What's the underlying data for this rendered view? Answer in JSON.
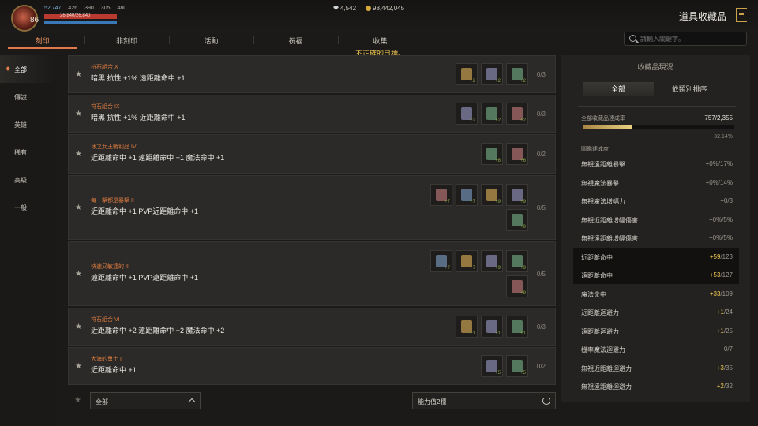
{
  "player": {
    "level": "86",
    "stats": [
      "52,747",
      "426",
      "390",
      "305",
      "480"
    ],
    "hp": "26,840/26,840",
    "hp_fraction": 1.0,
    "mp_fraction": 1.0
  },
  "currency": {
    "diamonds": "4,542",
    "gold": "98,442,045"
  },
  "window_title": "道具收藏品",
  "tabs": [
    "刻印",
    "非刻印",
    "活動",
    "祝福",
    "收集"
  ],
  "search": {
    "placeholder": "請輸入關鍵字。"
  },
  "warning": "不正確的目標。",
  "sidebar": [
    "全部",
    "傳說",
    "英雄",
    "稀有",
    "高級",
    "一般"
  ],
  "collections": [
    {
      "name": "符石組合 X",
      "effect": "暗黑 抗性 +1% 遠距離命中 +1",
      "count": "0/3",
      "slots": [
        "+2",
        "+2",
        "+2"
      ]
    },
    {
      "name": "符石組合 IX",
      "effect": "暗黑 抗性 +1% 近距離命中 +1",
      "count": "0/3",
      "slots": [
        "+2",
        "+2",
        "+2"
      ]
    },
    {
      "name": "冰之女王戰利品 IV",
      "effect": "近距離命中 +1 遠距離命中 +1 魔法命中 +1",
      "count": "0/2",
      "slots": [
        "+6",
        "+6"
      ]
    },
    {
      "name": "每一擊都是暴擊 II",
      "effect": "近距離命中 +1 PVP近距離命中 +1",
      "count": "0/5",
      "slots": [
        "+7",
        "+7",
        "+9",
        "+9",
        "+9"
      ]
    },
    {
      "name": "快速又敏捷的 II",
      "effect": "遠距離命中 +1 PVP遠距離命中 +1",
      "count": "0/5",
      "slots": [
        "+7",
        "+7",
        "+9",
        "+9",
        "+9"
      ]
    },
    {
      "name": "符石組合 VI",
      "effect": "近距離命中 +2 遠距離命中 +2 魔法命中 +2",
      "count": "0/3",
      "slots": [
        "+1",
        "+1",
        "+1"
      ]
    },
    {
      "name": "大海的勇士 I",
      "effect": "近距離命中 +1",
      "count": "0/2",
      "slots": [
        "+5",
        "+5"
      ]
    }
  ],
  "bottom": {
    "filter": "全部",
    "power_filter": "能力值2種"
  },
  "panel": {
    "title": "收藏品現況",
    "tabs": [
      "全部",
      "依類別排序"
    ],
    "progress_label": "全部收藏品達成率",
    "progress_value": "757/2,355",
    "progress_pct": "32.14%",
    "progress_fraction": 0.3214,
    "sub_label": "圖鑑達成度",
    "stats": [
      {
        "name": "無視遠距離暴擊",
        "bonus": "",
        "value": "+0%/17%",
        "highlight": false
      },
      {
        "name": "無視魔法暴擊",
        "bonus": "",
        "value": "+0%/14%",
        "highlight": false
      },
      {
        "name": "無視魔法增幅力",
        "bonus": "",
        "value": "+0/3",
        "highlight": false
      },
      {
        "name": "無視近距離增幅傷害",
        "bonus": "",
        "value": "+0%/5%",
        "highlight": false
      },
      {
        "name": "無視遠距離增幅傷害",
        "bonus": "",
        "value": "+0%/5%",
        "highlight": false
      },
      {
        "name": "近距離命中",
        "bonus": "+59",
        "value": "/123",
        "highlight": true
      },
      {
        "name": "遠距離命中",
        "bonus": "+53",
        "value": "/127",
        "highlight": true
      },
      {
        "name": "魔法命中",
        "bonus": "+33",
        "value": "/109",
        "highlight": false
      },
      {
        "name": "近距離迴避力",
        "bonus": "+1",
        "value": "/24",
        "highlight": false
      },
      {
        "name": "遠距離迴避力",
        "bonus": "+1",
        "value": "/25",
        "highlight": false
      },
      {
        "name": "機率魔法迴避力",
        "bonus": "",
        "value": "+0/7",
        "highlight": false
      },
      {
        "name": "無視近距離迴避力",
        "bonus": "+3",
        "value": "/35",
        "highlight": false
      },
      {
        "name": "無視遠距離迴避力",
        "bonus": "+2",
        "value": "/32",
        "highlight": false
      }
    ]
  },
  "colors": {
    "accent": "#e07a4a",
    "collection_name": "#d9793f",
    "bonus": "#f0c850",
    "warning": "#f0c850"
  }
}
